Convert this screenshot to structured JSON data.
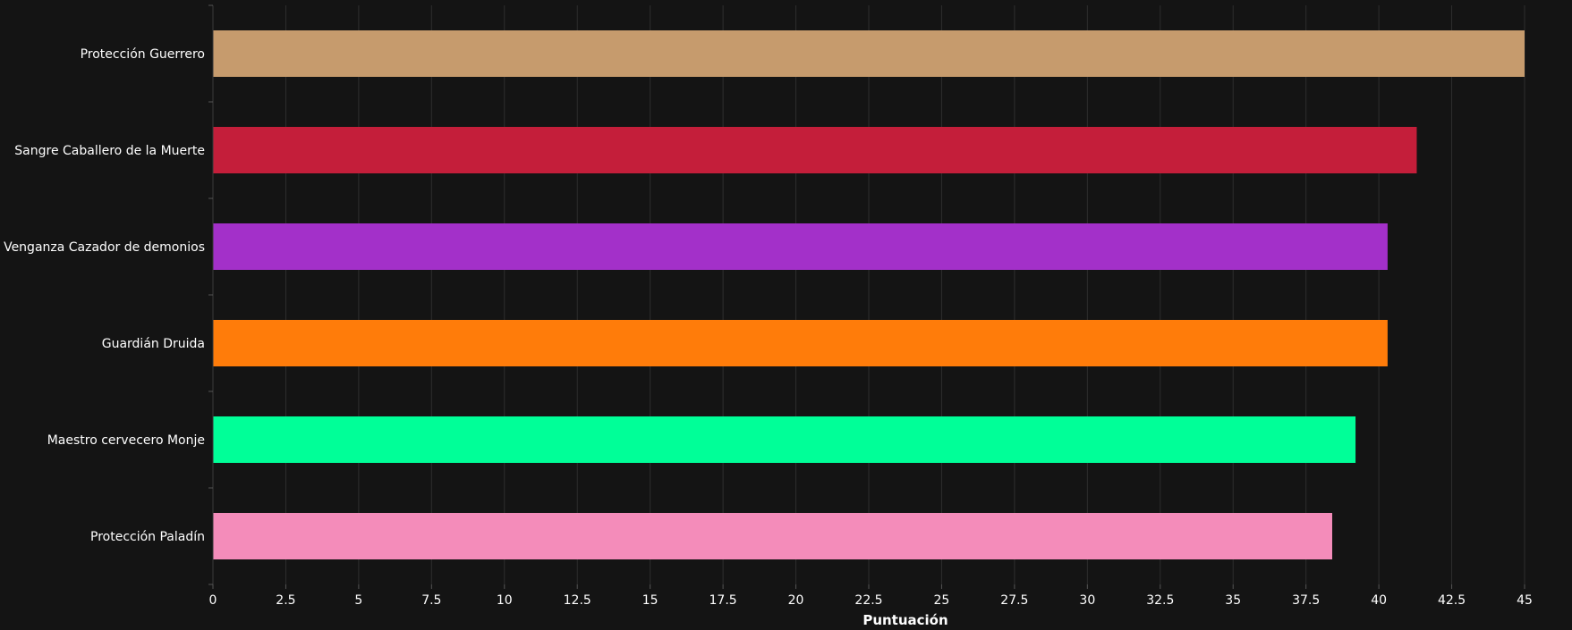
{
  "colors": {
    "background": "#141414",
    "grid": "#2e2e2e",
    "text": "#ffffff"
  },
  "chart_data": {
    "type": "bar",
    "orientation": "horizontal",
    "title": "",
    "xlabel": "Puntuación",
    "ylabel": "",
    "xlim": [
      0,
      45
    ],
    "x_ticks": [
      0,
      2.5,
      5,
      7.5,
      10,
      12.5,
      15,
      17.5,
      20,
      22.5,
      25,
      27.5,
      30,
      32.5,
      35,
      37.5,
      40,
      42.5,
      45
    ],
    "x_tick_labels": [
      "0",
      "2.5",
      "5",
      "7.5",
      "10",
      "12.5",
      "15",
      "17.5",
      "20",
      "22.5",
      "25",
      "27.5",
      "30",
      "32.5",
      "35",
      "37.5",
      "40",
      "42.5",
      "45"
    ],
    "grid": true,
    "legend": "none",
    "categories": [
      "Protección Guerrero",
      "Sangre Caballero de la Muerte",
      "Venganza Cazador de demonios",
      "Guardián Druida",
      "Maestro cervecero Monje",
      "Protección Paladín"
    ],
    "values": [
      45.0,
      41.3,
      40.3,
      40.3,
      39.2,
      38.4
    ],
    "bar_colors": [
      "#C69B6D",
      "#C41E3A",
      "#A330C9",
      "#FF7C0A",
      "#00FF98",
      "#F48CBA"
    ]
  }
}
